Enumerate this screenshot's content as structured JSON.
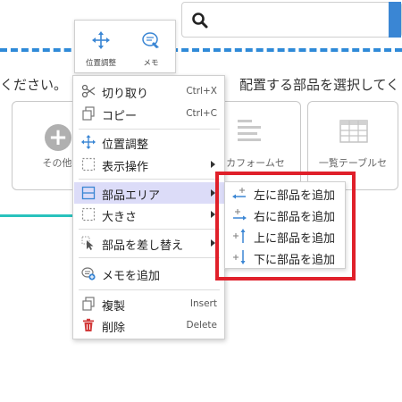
{
  "instructions": {
    "left_text": "ください。",
    "right_text": "配置する部品を選択してく"
  },
  "cards": [
    {
      "label": "その他",
      "icon": "plus-circle-icon"
    },
    {
      "label": "カフォームセ",
      "icon": "form-lines-icon"
    },
    {
      "label": "一覧テーブルセ",
      "icon": "table-grid-icon"
    }
  ],
  "float_toolbar": {
    "move_label": "位置調整",
    "memo_label": "メモ"
  },
  "context_menu": {
    "items": [
      {
        "label": "切り取り",
        "shortcut": "Ctrl+X",
        "icon": "scissors-icon"
      },
      {
        "label": "コピー",
        "shortcut": "Ctrl+C",
        "icon": "copy-icon"
      },
      {
        "label": "位置調整",
        "icon": "move-arrows-icon"
      },
      {
        "label": "表示操作",
        "icon": "dotted-square-icon"
      },
      {
        "label": "部品エリア",
        "icon": "area-split-icon"
      },
      {
        "label": "大きさ",
        "icon": "dotted-square-icon"
      },
      {
        "label": "部品を差し替え",
        "icon": "replace-cursor-icon"
      },
      {
        "label": "メモを追加",
        "icon": "memo-add-icon"
      },
      {
        "label": "複製",
        "shortcut": "Insert",
        "icon": "duplicate-icon"
      },
      {
        "label": "削除",
        "shortcut": "Delete",
        "icon": "trash-icon"
      }
    ]
  },
  "sub_menu": {
    "items": [
      {
        "label": "左に部品を追加",
        "icon": "add-left-icon"
      },
      {
        "label": "右に部品を追加",
        "icon": "add-right-icon"
      },
      {
        "label": "上に部品を追加",
        "icon": "add-up-icon"
      },
      {
        "label": "下に部品を追加",
        "icon": "add-down-icon"
      }
    ]
  },
  "colors": {
    "accent_blue": "#2f8ad8",
    "teal": "#29c2bd",
    "highlight_red": "#e0202a",
    "active_row": "#dcdcf8"
  }
}
